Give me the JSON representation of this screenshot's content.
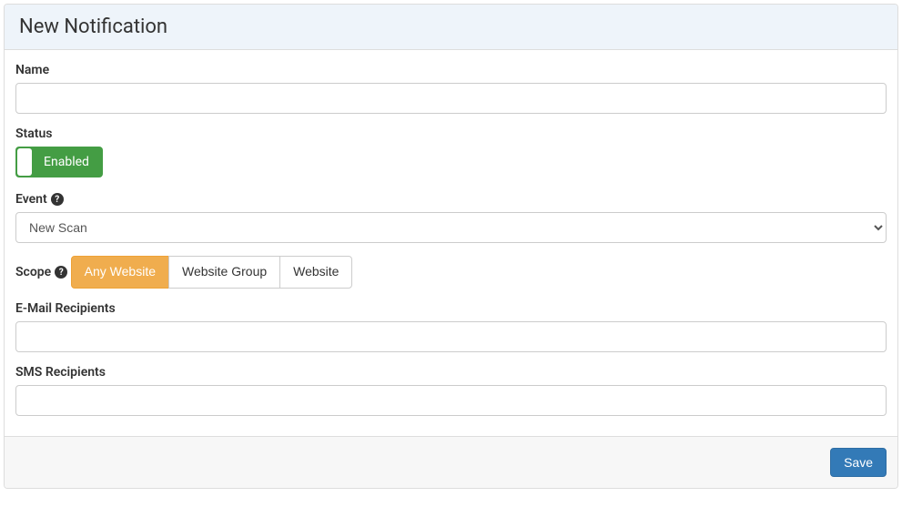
{
  "header": {
    "title": "New Notification"
  },
  "form": {
    "name": {
      "label": "Name",
      "value": ""
    },
    "status": {
      "label": "Status",
      "toggle_label": "Enabled"
    },
    "event": {
      "label": "Event",
      "selected": "New Scan"
    },
    "scope": {
      "label": "Scope",
      "options": {
        "any_website": "Any Website",
        "website_group": "Website Group",
        "website": "Website"
      }
    },
    "email": {
      "label": "E-Mail Recipients",
      "value": ""
    },
    "sms": {
      "label": "SMS Recipients",
      "value": ""
    }
  },
  "footer": {
    "save": "Save"
  }
}
